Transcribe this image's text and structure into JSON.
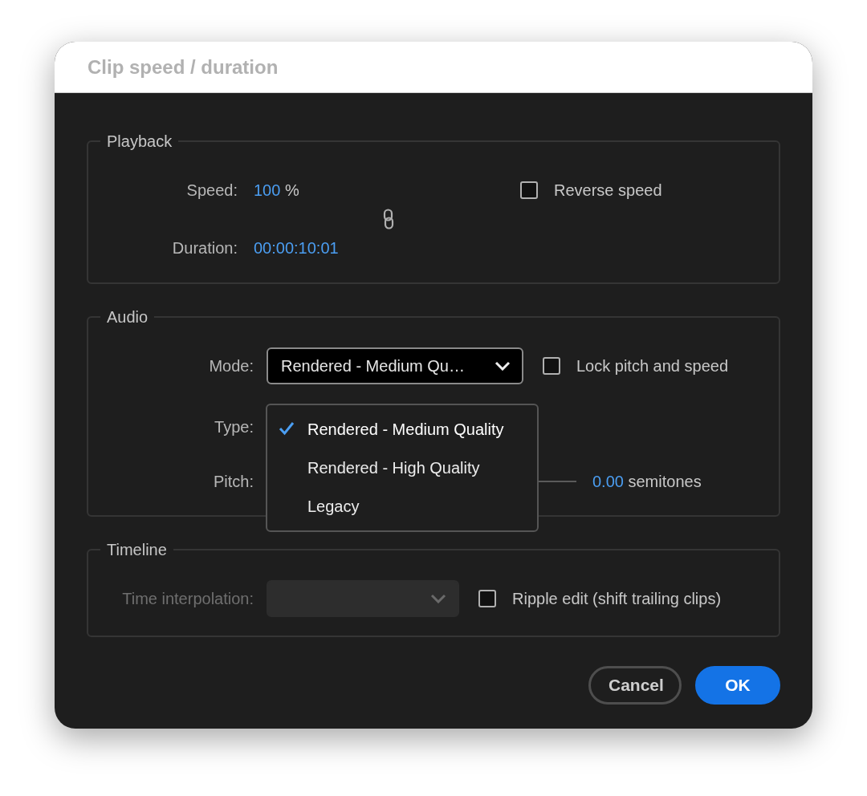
{
  "window": {
    "title": "Clip speed / duration"
  },
  "playback": {
    "legend": "Playback",
    "speed": {
      "label": "Speed:",
      "value": "100",
      "unit": "%"
    },
    "duration": {
      "label": "Duration:",
      "value": "00:00:10:01"
    },
    "reverse_speed": {
      "label": "Reverse speed",
      "checked": false
    }
  },
  "audio": {
    "legend": "Audio",
    "mode": {
      "label": "Mode:",
      "value": "Rendered - Medium Qu…",
      "expanded": true
    },
    "lock_pitch": {
      "label": "Lock pitch and speed",
      "checked": false
    },
    "type": {
      "label": "Type:"
    },
    "pitch": {
      "label": "Pitch:",
      "value": "0.00",
      "unit": "semitones"
    },
    "menu": [
      {
        "label": "Rendered - Medium Quality",
        "selected": true
      },
      {
        "label": "Rendered - High Quality",
        "selected": false
      },
      {
        "label": "Legacy",
        "selected": false
      }
    ]
  },
  "timeline": {
    "legend": "Timeline",
    "time_interpolation": {
      "label": "Time interpolation:",
      "disabled": true
    },
    "ripple_edit": {
      "label": "Ripple edit (shift trailing clips)",
      "checked": false
    }
  },
  "buttons": [
    {
      "label": "Cancel",
      "kind": "secondary"
    },
    {
      "label": "OK",
      "kind": "primary"
    }
  ]
}
